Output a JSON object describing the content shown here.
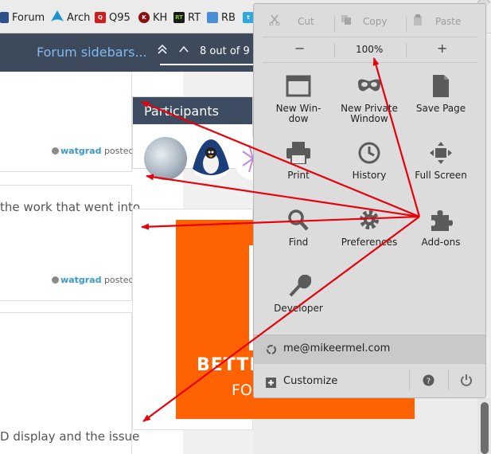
{
  "bookmarks": [
    {
      "label": "Forum",
      "icon": "forum-icon"
    },
    {
      "label": "Arch",
      "icon": "arch-icon"
    },
    {
      "label": "Q95",
      "icon": "q95-icon"
    },
    {
      "label": "KH",
      "icon": "kh-icon"
    },
    {
      "label": "RT",
      "icon": "rt-icon"
    },
    {
      "label": "RB",
      "icon": "rb-icon"
    }
  ],
  "header": {
    "topic_title": "Forum sidebars...",
    "progress": "8 out of 9"
  },
  "posts": {
    "author": "watgrad",
    "posted": "posted a",
    "text_1": "the work that went into",
    "text_2": "D display and the issue"
  },
  "sidebar": {
    "participants_title": "Participants"
  },
  "ad": {
    "line1": "BETTER",
    "line2": "FO"
  },
  "menu": {
    "cut": "Cut",
    "copy": "Copy",
    "paste": "Paste",
    "zoom_out": "−",
    "zoom_level": "100%",
    "zoom_in": "+",
    "tiles": [
      {
        "line1": "New Win-",
        "line2": "dow",
        "icon": "new-window-icon"
      },
      {
        "line1": "New Private",
        "line2": "Window",
        "icon": "private-window-icon"
      },
      {
        "line1": "Save Page",
        "line2": "",
        "icon": "save-page-icon"
      },
      {
        "line1": "Print",
        "line2": "",
        "icon": "print-icon"
      },
      {
        "line1": "History",
        "line2": "",
        "icon": "history-icon"
      },
      {
        "line1": "Full Screen",
        "line2": "",
        "icon": "fullscreen-icon"
      },
      {
        "line1": "Find",
        "line2": "",
        "icon": "find-icon"
      },
      {
        "line1": "Preferences",
        "line2": "",
        "icon": "preferences-icon"
      },
      {
        "line1": "Add-ons",
        "line2": "",
        "icon": "addons-icon"
      },
      {
        "line1": "Developer",
        "line2": "",
        "icon": "developer-icon"
      }
    ],
    "account": "me@mikeermel.com",
    "customize": "Customize"
  },
  "colors": {
    "header_bg": "#3c4a5c",
    "link_blue": "#3a97cc",
    "ad_orange": "#ff6200",
    "arrow_red": "#e8000a",
    "menu_bg": "#dcdcdc"
  }
}
